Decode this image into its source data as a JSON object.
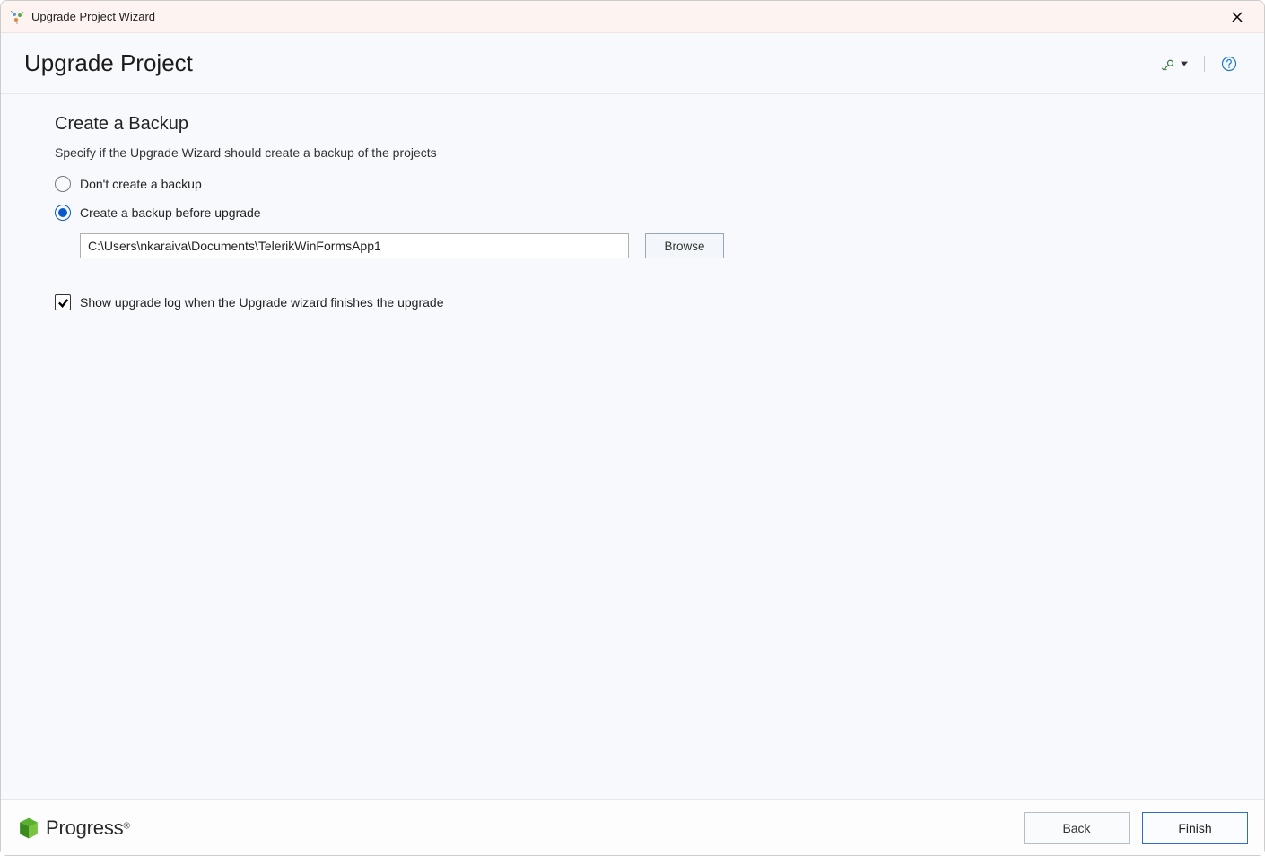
{
  "window": {
    "title": "Upgrade Project Wizard"
  },
  "header": {
    "title": "Upgrade Project"
  },
  "content": {
    "section_title": "Create a Backup",
    "section_desc": "Specify if the Upgrade Wizard should create a backup of the projects",
    "radio_no_backup": "Don't create a backup",
    "radio_create_backup": "Create a backup before upgrade",
    "backup_path": "C:\\Users\\nkaraiva\\Documents\\TelerikWinFormsApp1",
    "browse_label": "Browse",
    "checkbox_showlog": "Show upgrade log when the Upgrade wizard finishes the upgrade"
  },
  "footer": {
    "brand": "Progress",
    "back_label": "Back",
    "finish_label": "Finish"
  },
  "icons": {
    "settings": "settings-icon",
    "dropdown": "chevron-down-icon",
    "help": "help-icon"
  }
}
